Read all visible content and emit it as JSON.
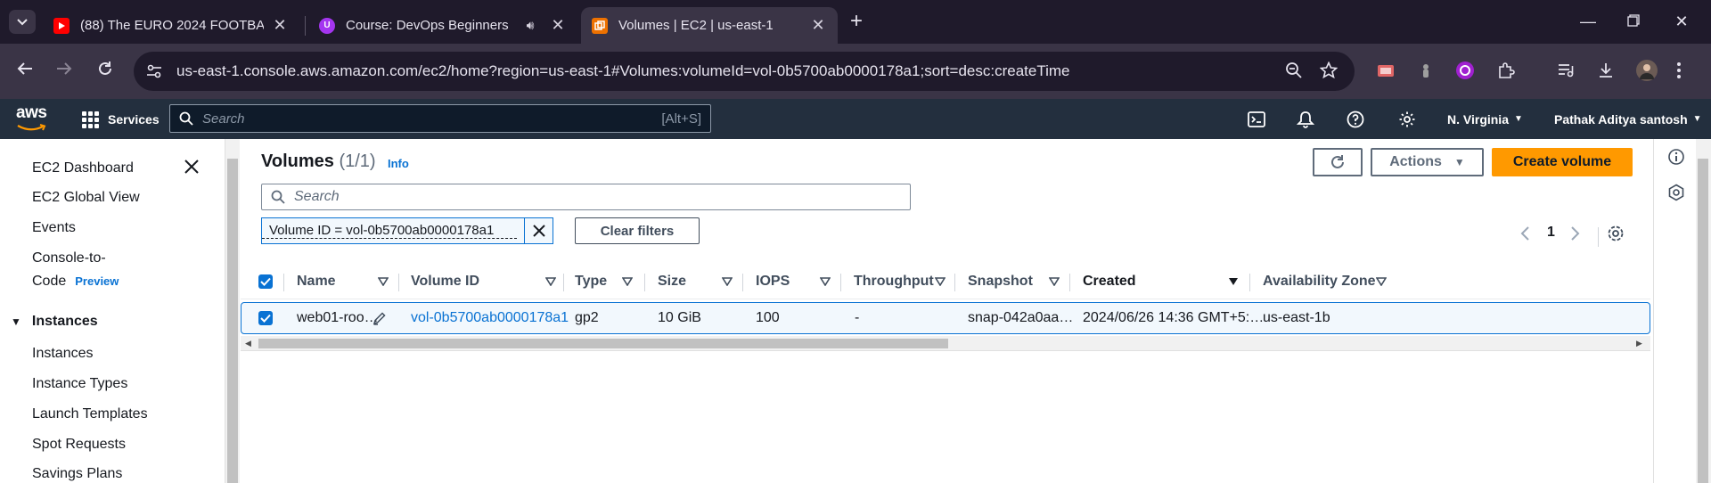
{
  "browser": {
    "tabs": [
      {
        "title": "(88) The EURO 2024 FOOTBALL",
        "icon": "youtube-icon"
      },
      {
        "title": "Course: DevOps Beginners t",
        "icon": "udemy-icon"
      },
      {
        "title": "Volumes | EC2 | us-east-1",
        "icon": "aws-icon",
        "active": true
      }
    ],
    "url": "us-east-1.console.aws.amazon.com/ec2/home?region=us-east-1#Volumes:volumeId=vol-0b5700ab0000178a1;sort=desc:createTime"
  },
  "aws_nav": {
    "logo": "aws",
    "services_label": "Services",
    "search_placeholder": "Search",
    "search_shortcut": "[Alt+S]",
    "region": "N. Virginia",
    "account": "Pathak Aditya santosh"
  },
  "sidebar": {
    "items": [
      "EC2 Dashboard",
      "EC2 Global View",
      "Events"
    ],
    "console_to_code": {
      "line1": "Console-to-",
      "line2": "Code",
      "badge": "Preview"
    },
    "section_title": "Instances",
    "section_items": [
      "Instances",
      "Instance Types",
      "Launch Templates",
      "Spot Requests",
      "Savings Plans"
    ]
  },
  "main": {
    "title": "Volumes",
    "count": "(1/1)",
    "info": "Info",
    "actions_label": "Actions",
    "create_label": "Create volume",
    "search_placeholder": "Search",
    "filter_token": "Volume ID = vol-0b5700ab0000178a1",
    "clear_filters": "Clear filters",
    "page": "1",
    "columns": [
      "Name",
      "Volume ID",
      "Type",
      "Size",
      "IOPS",
      "Throughput",
      "Snapshot",
      "Created",
      "Availability Zone"
    ],
    "rows": [
      {
        "name": "web01-roo…",
        "volume_id": "vol-0b5700ab0000178a1",
        "type": "gp2",
        "size": "10 GiB",
        "iops": "100",
        "throughput": "-",
        "snapshot": "snap-042a0aa…",
        "created": "2024/06/26 14:36 GMT+5:…",
        "az": "us-east-1b"
      }
    ]
  },
  "colors": {
    "tabbar": "#1f1a2b",
    "toolbar": "#3a3446",
    "aws_nav": "#232f3e",
    "primary": "#ff9900",
    "link": "#0972d3"
  }
}
